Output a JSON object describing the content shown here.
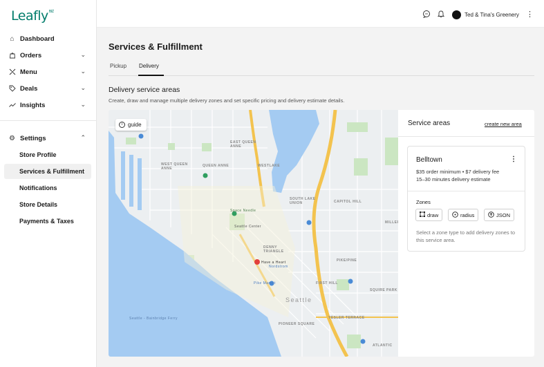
{
  "logo": "Leafly",
  "logo_mark": "BIZ",
  "sidebar": {
    "items": [
      {
        "label": "Dashboard",
        "icon": "home-icon"
      },
      {
        "label": "Orders",
        "icon": "bag-icon"
      },
      {
        "label": "Menu",
        "icon": "menu-icon"
      },
      {
        "label": "Deals",
        "icon": "tag-icon"
      },
      {
        "label": "Insights",
        "icon": "trend-icon"
      }
    ],
    "settings": {
      "label": "Settings",
      "icon": "gear-icon",
      "sub_items": [
        "Store Profile",
        "Services & Fulfillment",
        "Notifications",
        "Store Details",
        "Payments & Taxes"
      ],
      "active": "Services & Fulfillment"
    }
  },
  "topbar": {
    "store_name": "Ted & Tina's Greenery",
    "icons": [
      "chat-icon",
      "bell-icon",
      "avatar",
      "kebab-icon"
    ]
  },
  "main": {
    "title": "Services & Fulfillment",
    "tabs": [
      "Pickup",
      "Delivery"
    ],
    "active_tab": "Delivery",
    "section_title": "Delivery service areas",
    "section_desc": "Create, draw and manage multiple delivery zones and set specific pricing and delivery estimate details."
  },
  "map": {
    "guide_label": "guide",
    "labels": {
      "east_queen_anne": "EAST QUEEN\nANNE",
      "west_queen_anne": "WEST QUEEN\nANNE",
      "queen_anne": "QUEEN ANNE",
      "westlake": "WESTLAKE",
      "south_lake_union": "SOUTH LAKE\nUNION",
      "capitol_hill": "CAPITOL HILL",
      "denny_triangle": "DENNY\nTRIANGLE",
      "pike_pine": "PIKE/PINE",
      "first_hill": "FIRST HILL",
      "seattle": "Seattle",
      "yesler_terrace": "YESLER TERRACE",
      "pioneer_square": "PIONEER SQUARE",
      "atlantic": "ATLANTIC",
      "squire_park": "SQUIRE PARK",
      "miller": "MILLER",
      "ferry": "Seattle - Bainbridge Ferry",
      "pike_market": "Pike Market",
      "space_needle": "Space Needle",
      "seattle_center": "Seattle Center",
      "have_a_heart": "Have a Heart",
      "nordstrom": "Nordstrom"
    },
    "colors": {
      "water": "#a4cbf2",
      "land": "#eceff1",
      "highway": "#f3c34f",
      "park": "#cbe6c2"
    }
  },
  "service_panel": {
    "title": "Service areas",
    "create_link": "create new area",
    "card": {
      "name": "Belltown",
      "line1": "$35 order minimum • $7 delivery fee",
      "line2": "15–30 minutes delivery estimate",
      "zones_label": "Zones",
      "zone_buttons": [
        {
          "label": "draw",
          "icon": "square-icon"
        },
        {
          "label": "radius",
          "icon": "radius-icon"
        },
        {
          "label": "JSON",
          "icon": "upload-icon"
        }
      ],
      "help": "Select a zone type to add delivery zones to this service area."
    }
  }
}
